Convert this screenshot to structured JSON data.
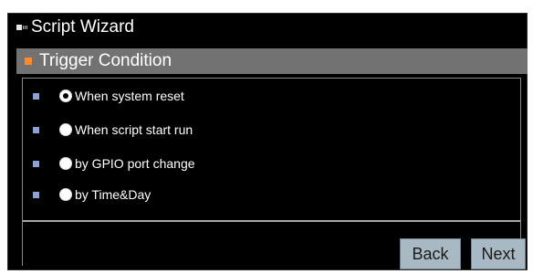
{
  "wizard": {
    "title": "Script Wizard"
  },
  "section": {
    "title": "Trigger Condition"
  },
  "options": [
    {
      "label": "When system reset",
      "selected": true
    },
    {
      "label": "When script start run",
      "selected": false
    },
    {
      "label": "by GPIO port change",
      "selected": false
    },
    {
      "label": "by Time&Day",
      "selected": false
    }
  ],
  "buttons": {
    "back": "Back",
    "next": "Next"
  },
  "colors": {
    "background": "#000000",
    "section_header": "#727272",
    "section_marker": "#ff8a2e",
    "option_bullet": "#8fa2cf",
    "button": "#a9b9c4"
  }
}
